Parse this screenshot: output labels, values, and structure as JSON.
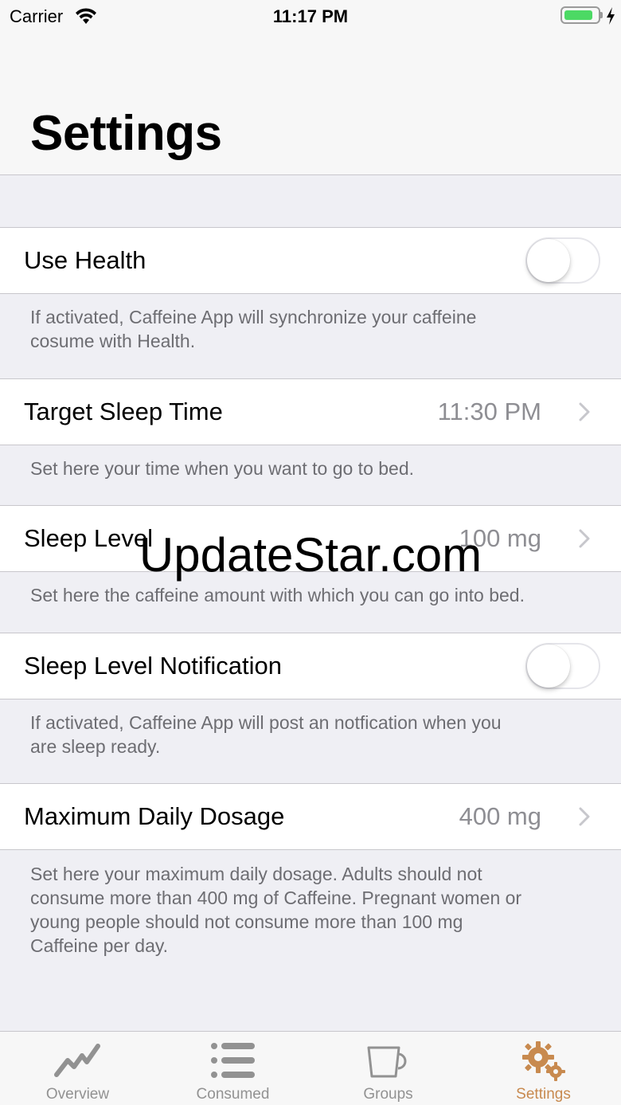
{
  "status_bar": {
    "carrier": "Carrier",
    "time": "11:17 PM",
    "battery_level": 0.9
  },
  "nav": {
    "title": "Settings"
  },
  "rows": {
    "use_health": {
      "label": "Use Health",
      "on": false,
      "footer_line1": "If activated, Caffeine App will synchronize your caffeine",
      "footer_line2": "cosume with Health."
    },
    "target_sleep": {
      "label": "Target Sleep Time",
      "value": "11:30 PM",
      "footer_line1": "Set here your time when you want to go to bed."
    },
    "sleep_level": {
      "label": "Sleep Level",
      "value": "100 mg",
      "footer_line1": "Set here the caffeine amount with which you can go into bed."
    },
    "sleep_notification": {
      "label": "Sleep Level Notification",
      "on": false,
      "footer_line1": "If activated, Caffeine App will post an notfication when you",
      "footer_line2": "are sleep ready."
    },
    "max_dosage": {
      "label": "Maximum Daily Dosage",
      "value": "400 mg",
      "footer_line1": "Set here your maximum daily dosage. Adults should not",
      "footer_line2": "consume more than 400 mg of Caffeine. Pregnant women or",
      "footer_line3": "young people should not consume more than 100 mg",
      "footer_line4": "Caffeine per day."
    }
  },
  "watermark": "UpdateStar.com",
  "tabbar": {
    "tabs": [
      {
        "label": "Overview",
        "icon": "chart-line-icon"
      },
      {
        "label": "Consumed",
        "icon": "list-icon"
      },
      {
        "label": "Groups",
        "icon": "cup-icon"
      },
      {
        "label": "Settings",
        "icon": "gears-icon"
      }
    ],
    "active_tab": "Settings"
  },
  "colors": {
    "accent": "#c88a4f",
    "inactive_tab": "#929292",
    "background": "#efeff4",
    "footer_text": "#6d6d72",
    "value_text": "#8e8e93",
    "battery_green": "#4cd964"
  }
}
